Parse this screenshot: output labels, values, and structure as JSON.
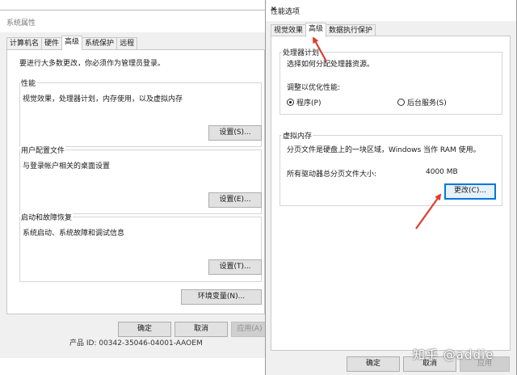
{
  "system_properties": {
    "title": "系统属性",
    "tabs": [
      "计算机名",
      "硬件",
      "高级",
      "系统保护",
      "远程"
    ],
    "active_tab": "高级",
    "notice": "要进行大多数更改，你必须作为管理员登录。",
    "performance": {
      "title": "性能",
      "desc": "视觉效果，处理器计划，内存使用，以及虚拟内存",
      "button": "设置(S)..."
    },
    "user_profiles": {
      "title": "用户配置文件",
      "desc": "与登录帐户相关的桌面设置",
      "button": "设置(E)..."
    },
    "startup_recovery": {
      "title": "启动和故障恢复",
      "desc": "系统启动、系统故障和调试信息",
      "button": "设置(T)..."
    },
    "env_button": "环境变量(N)...",
    "footer": {
      "ok": "确定",
      "cancel": "取消",
      "apply": "应用(A)"
    },
    "product_id": "产品 ID: 00342-35046-04001-AAOEM"
  },
  "performance_options": {
    "title": "性能选项",
    "tabs": [
      "视觉效果",
      "高级",
      "数据执行保护"
    ],
    "active_tab": "高级",
    "processor": {
      "title": "处理器计划",
      "desc": "选择如何分配处理器资源。",
      "adjust_label": "调整以优化性能:",
      "options": [
        {
          "label": "程序(P)",
          "selected": true
        },
        {
          "label": "后台服务(S)",
          "selected": false
        }
      ]
    },
    "virtual_memory": {
      "title": "虚拟内存",
      "desc": "分页文件是硬盘上的一块区域，Windows 当作 RAM 使用。",
      "total_label": "所有驱动器总分页文件大小:",
      "total_value": "4000 MB",
      "change_button": "更改(C)..."
    },
    "footer": {
      "ok": "确定",
      "cancel": "取消",
      "apply": "应用"
    }
  },
  "annotation": {
    "arrow_color": "#e03c31"
  },
  "watermark": "知乎 @addie"
}
